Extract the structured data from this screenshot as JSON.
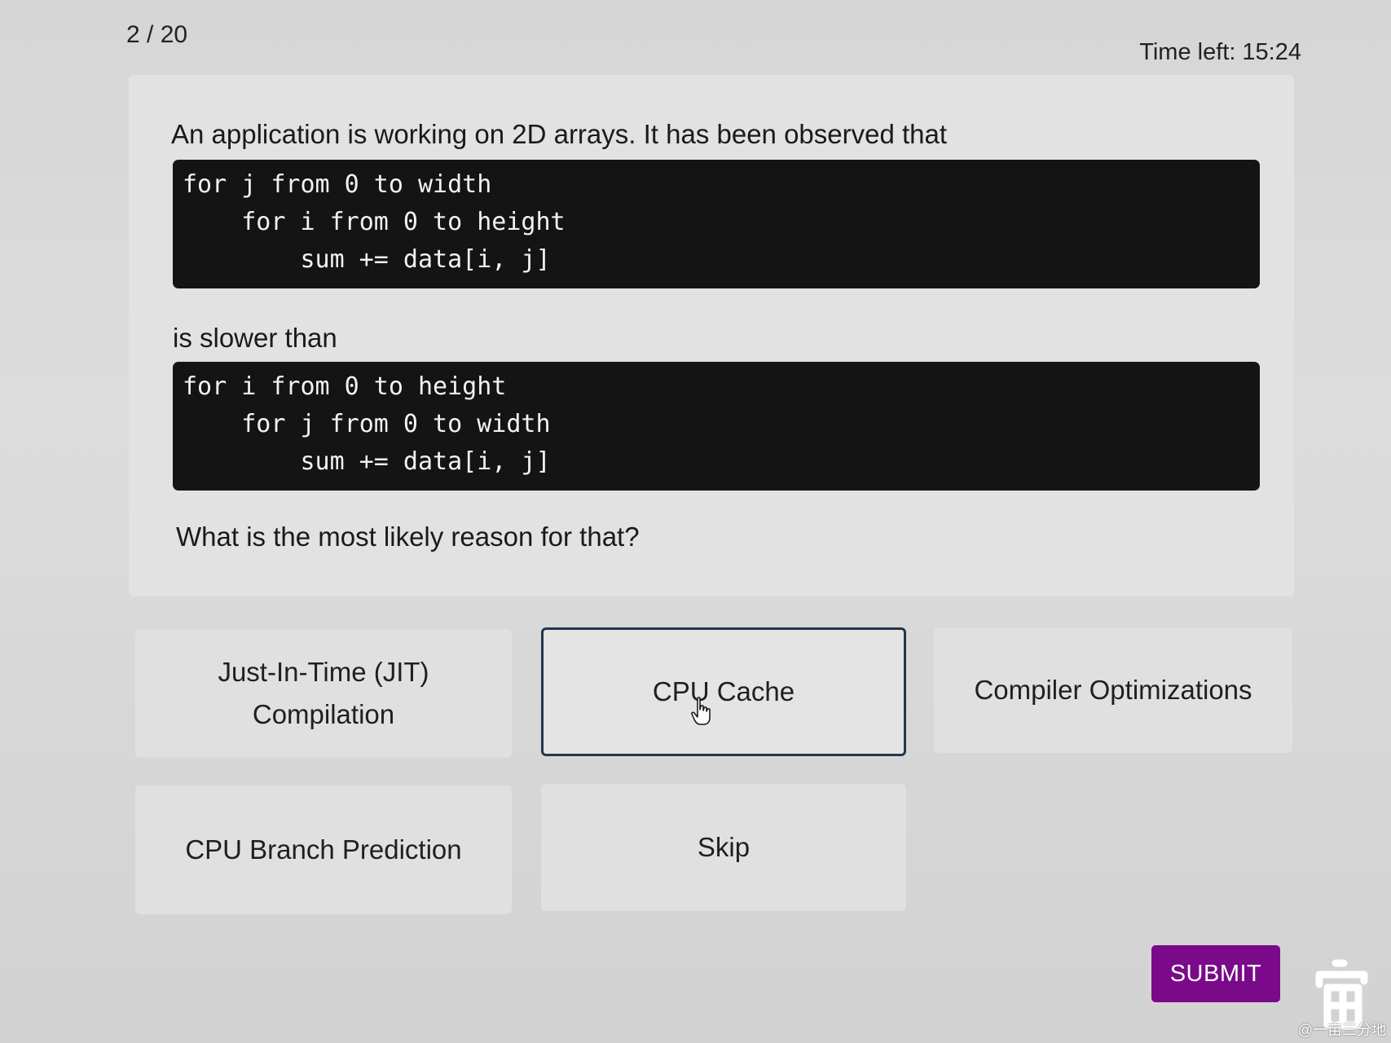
{
  "progress": {
    "counter": "2 / 20"
  },
  "timer": {
    "label": "Time left: 15:24"
  },
  "question": {
    "intro": "An application is working on 2D arrays. It has been observed that",
    "code_slow": [
      "for j from 0 to width",
      "    for i from 0 to height",
      "        sum += data[i, j]"
    ],
    "middle": "is slower than",
    "code_fast": [
      "for i from 0 to height",
      "    for j from 0 to width",
      "        sum += data[i, j]"
    ],
    "ask": "What is the most likely reason for that?"
  },
  "options": {
    "jit_line1": "Just-In-Time (JIT)",
    "jit_line2": "Compilation",
    "cache": "CPU Cache",
    "compiler": "Compiler Optimizations",
    "branch": "CPU Branch Prediction",
    "skip": "Skip",
    "selected": "CPU Cache"
  },
  "submit": {
    "label": "SUBMIT",
    "color": "#7a0a8a"
  },
  "watermark": {
    "text": "@一亩三分地"
  }
}
